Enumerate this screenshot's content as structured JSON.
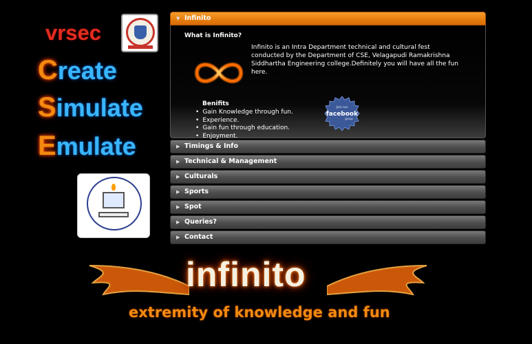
{
  "brand": {
    "short_name": "vrsec",
    "cse_words": [
      {
        "first": "C",
        "rest": "reate"
      },
      {
        "first": "S",
        "rest": "imulate"
      },
      {
        "first": "E",
        "rest": "mulate"
      }
    ]
  },
  "accordion": {
    "sections": [
      {
        "label": "Infinito",
        "expanded": true
      },
      {
        "label": "Timings & Info",
        "expanded": false
      },
      {
        "label": "Technical & Management",
        "expanded": false
      },
      {
        "label": "Culturals",
        "expanded": false
      },
      {
        "label": "Sports",
        "expanded": false
      },
      {
        "label": "Spot",
        "expanded": false
      },
      {
        "label": "Queries?",
        "expanded": false
      },
      {
        "label": "Contact",
        "expanded": false
      }
    ],
    "active_panel": {
      "title": "What is Infinito?",
      "description": "Infinito is an Intra Department technical and cultural fest conducted by the Department of CSE, Velagapudi Ramakrishna Siddhartha Engineering college.Definitely you will have all the fun here.",
      "benefits_title": "Benifits",
      "benefits": [
        "Gain Knowledge through fun.",
        "Experience.",
        "Gain fun through education.",
        "Enjoyment."
      ],
      "facebook_badge": {
        "top": "Join our",
        "name": "facebook",
        "bottom": "group"
      }
    }
  },
  "footer_logo": {
    "wordmark": "infinito",
    "tagline": "extremity of knowledge and fun"
  },
  "colors": {
    "accent_orange": "#e57c0d",
    "cse_blue": "#39b6ff",
    "vrsec_red": "#e32c1f",
    "facebook_blue": "#3b5998"
  },
  "icons": {
    "expanded_arrow": "triangle-down",
    "collapsed_arrow": "triangle-right"
  }
}
